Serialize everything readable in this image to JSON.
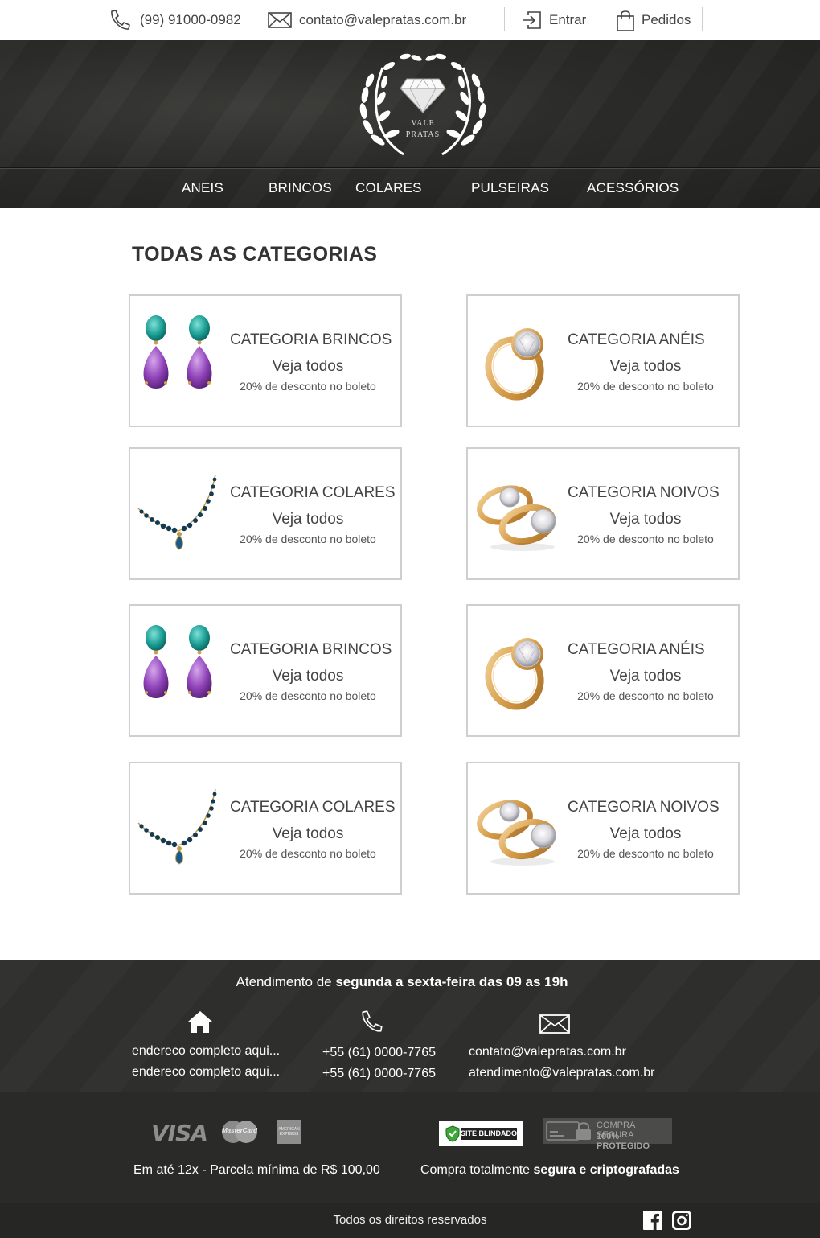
{
  "topbar": {
    "phone": "(99) 91000-0982",
    "email": "contato@valepratas.com.br",
    "login": "Entrar",
    "orders": "Pedidos"
  },
  "brand": {
    "line1": "VALE",
    "line2": "PRATAS"
  },
  "nav": [
    "ANEIS",
    "BRINCOS",
    "COLARES",
    "PULSEIRAS",
    "ACESSÓRIOS"
  ],
  "main": {
    "title": "TODAS AS CATEGORIAS",
    "cards": [
      {
        "title": "CATEGORIA BRINCOS",
        "link": "Veja todos",
        "promo": "20% de desconto no boleto",
        "image": "earrings-image"
      },
      {
        "title": "CATEGORIA ANÉIS",
        "link": "Veja todos",
        "promo": "20% de desconto no boleto",
        "image": "ring-image"
      },
      {
        "title": "CATEGORIA COLARES",
        "link": "Veja todos",
        "promo": "20% de desconto no boleto",
        "image": "necklace-image"
      },
      {
        "title": "CATEGORIA NOIVOS",
        "link": "Veja todos",
        "promo": "20% de desconto no boleto",
        "image": "wedding-rings-image"
      },
      {
        "title": "CATEGORIA BRINCOS",
        "link": "Veja todos",
        "promo": "20% de desconto no boleto",
        "image": "earrings-image"
      },
      {
        "title": "CATEGORIA ANÉIS",
        "link": "Veja todos",
        "promo": "20% de desconto no boleto",
        "image": "ring-image"
      },
      {
        "title": "CATEGORIA COLARES",
        "link": "Veja todos",
        "promo": "20% de desconto no boleto",
        "image": "necklace-image"
      },
      {
        "title": "CATEGORIA NOIVOS",
        "link": "Veja todos",
        "promo": "20% de desconto no boleto",
        "image": "wedding-rings-image"
      }
    ]
  },
  "footer": {
    "hours_prefix": "Atendimento de ",
    "hours_bold": "segunda a sexta-feira das 09 as 19h",
    "address": [
      "endereco completo aqui...",
      "endereco completo aqui..."
    ],
    "phones": [
      "+55 (61) 0000-7765",
      "+55 (61) 0000-7765"
    ],
    "emails": [
      "contato@valepratas.com.br",
      "atendimento@valepratas.com.br"
    ],
    "payment_brands": [
      "VISA",
      "MasterCard",
      "AMERICAN EXPRESS"
    ],
    "installments": "Em até 12x - Parcela mínima de R$ 100,00",
    "secure_prefix": "Compra totalmente ",
    "secure_bold": "segura e criptografadas",
    "site_blindado": "SITE BLINDADO",
    "compra_segura_1": "COMPRA SEGURA",
    "compra_segura_2": "100% PROTEGIDO",
    "rights": "Todos os direitos reservados"
  }
}
